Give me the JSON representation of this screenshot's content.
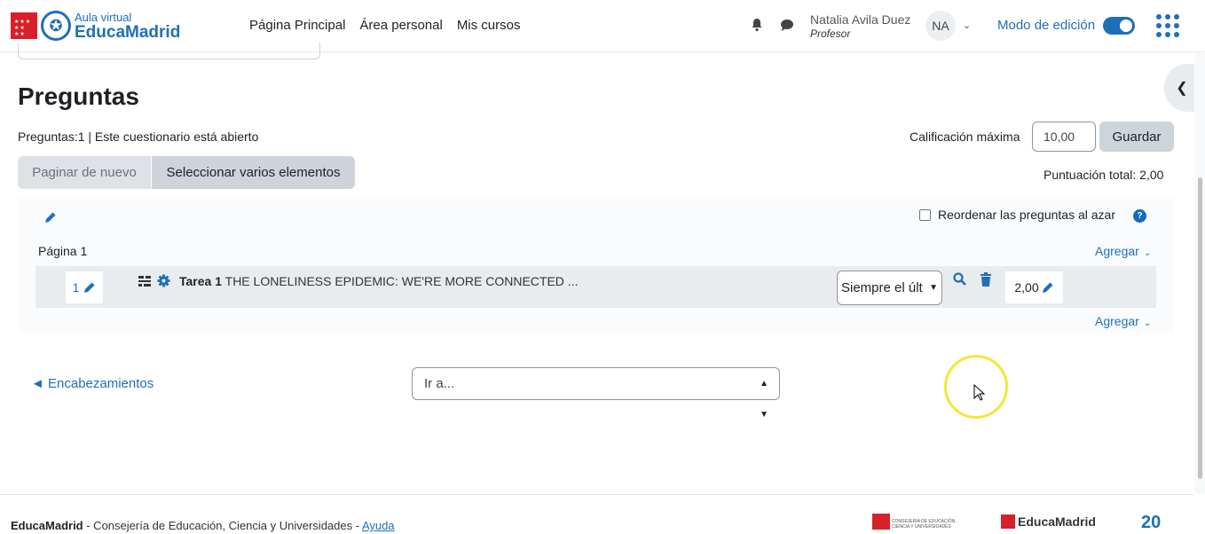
{
  "brand": {
    "small": "Aula virtual",
    "big": "EducaMadrid"
  },
  "nav": {
    "home": "Página Principal",
    "personal": "Área personal",
    "courses": "Mis cursos"
  },
  "user": {
    "name": "Natalia Avila Duez",
    "role": "Profesor",
    "initials": "NA"
  },
  "edit_mode": {
    "label": "Modo de edición",
    "enabled": true
  },
  "page": {
    "title": "Preguntas",
    "status": "Preguntas:1 | Este cuestionario está abierto",
    "max_grade_label": "Calificación máxima",
    "max_grade_value": "10,00",
    "save_label": "Guardar",
    "repaginate_label": "Paginar de nuevo",
    "select_multiple_label": "Seleccionar varios elementos",
    "total_score": "Puntuación total: 2,00"
  },
  "section": {
    "shuffle_label": "Reordenar las preguntas al azar",
    "shuffle_checked": false,
    "page_label": "Página 1",
    "add_label": "Agregar"
  },
  "question": {
    "slot": "1",
    "name": "Tarea 1",
    "text": "THE LONELINESS EPIDEMIC: WE'RE MORE CONNECTED ...",
    "dependency": "Siempre el últ",
    "mark": "2,00"
  },
  "navigation": {
    "back_label": "◄ Encabezamientos",
    "jump_placeholder": "Ir a..."
  },
  "footer": {
    "brand": "EducaMadrid",
    "text": " - Consejería de Educación, Ciencia y Universidades - ",
    "help": "Ayuda",
    "consejeria_text": "CONSEJERÍA DE EDUCACIÓN, CIENCIA Y UNIVERSIDADES",
    "logo_text": "EducaMadrid",
    "anniversary": "20"
  },
  "colors": {
    "accent": "#1f6fb8",
    "brand_red": "#d8202b",
    "help_blue": "#0f6cbf"
  }
}
